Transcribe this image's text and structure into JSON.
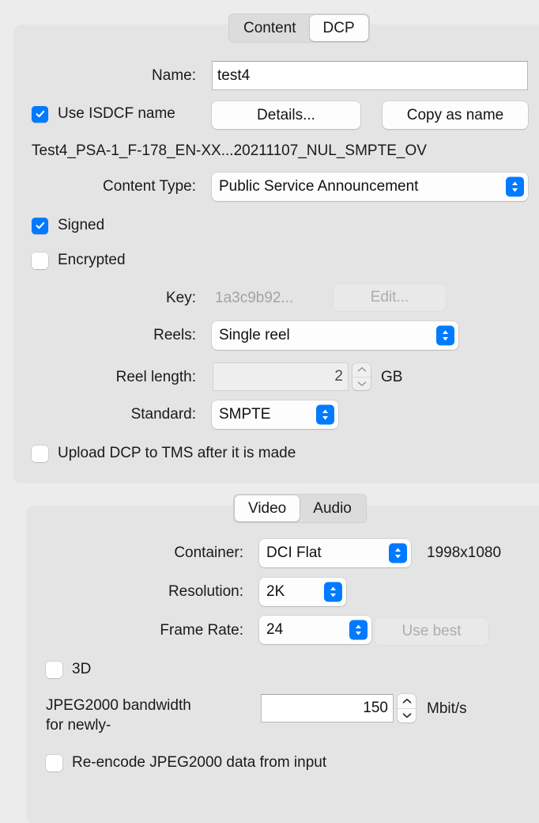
{
  "window": {
    "tabs_top": [
      {
        "label": "Content",
        "selected": false
      },
      {
        "label": "DCP",
        "selected": true
      }
    ]
  },
  "dcp": {
    "name_label": "Name:",
    "name_value": "test4",
    "use_isdcf_name": {
      "label": "Use ISDCF name",
      "checked": true
    },
    "details_button": "Details...",
    "copy_as_name_button": "Copy as name",
    "isdcf_name": "Test4_PSA-1_F-178_EN-XX...20211107_NUL_SMPTE_OV",
    "content_type_label": "Content Type:",
    "content_type_value": "Public Service Announcement",
    "signed": {
      "label": "Signed",
      "checked": true
    },
    "encrypted": {
      "label": "Encrypted",
      "checked": false
    },
    "key_label": "Key:",
    "key_value": "1a3c9b92...",
    "edit_button": "Edit...",
    "reels_label": "Reels:",
    "reels_value": "Single reel",
    "reel_length_label": "Reel length:",
    "reel_length_value": "2",
    "reel_length_unit": "GB",
    "standard_label": "Standard:",
    "standard_value": "SMPTE",
    "upload_tms": {
      "label": "Upload DCP to TMS after it is made",
      "checked": false
    }
  },
  "video": {
    "tabs": [
      {
        "label": "Video",
        "selected": true
      },
      {
        "label": "Audio",
        "selected": false
      }
    ],
    "container_label": "Container:",
    "container_value": "DCI Flat",
    "container_dimensions": "1998x1080",
    "resolution_label": "Resolution:",
    "resolution_value": "2K",
    "frame_rate_label": "Frame Rate:",
    "frame_rate_value": "24",
    "use_best_button": "Use best",
    "three_d": {
      "label": "3D",
      "checked": false
    },
    "bandwidth_label_line1": "JPEG2000 bandwidth",
    "bandwidth_label_line2": "for newly-",
    "bandwidth_value": "150",
    "bandwidth_unit": "Mbit/s",
    "reencode": {
      "label": "Re-encode JPEG2000 data from input",
      "checked": false
    }
  },
  "colors": {
    "accent": "#007aff",
    "window_bg": "#ececec",
    "group_bg": "#e4e4e4"
  }
}
